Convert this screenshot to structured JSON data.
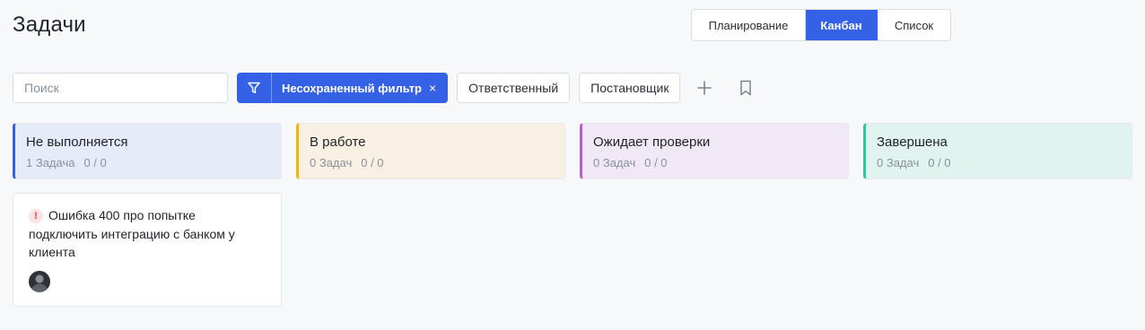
{
  "header": {
    "title": "Задачи",
    "views": [
      "Планирование",
      "Канбан",
      "Список"
    ],
    "active_view": "Канбан"
  },
  "toolbar": {
    "search_placeholder": "Поиск",
    "filter_label": "Несохраненный фильтр",
    "filter_close": "×",
    "assignee_label": "Ответственный",
    "reporter_label": "Постановщик"
  },
  "columns": [
    {
      "title": "Не выполняется",
      "count_label": "1 Задача",
      "ratio": "0 / 0",
      "accent": "#3461e6",
      "bg": "#e6ebf9"
    },
    {
      "title": "В работе",
      "count_label": "0 Задач",
      "ratio": "0 / 0",
      "accent": "#f2b705",
      "bg": "#f8f0e2"
    },
    {
      "title": "Ожидает проверки",
      "count_label": "0 Задач",
      "ratio": "0 / 0",
      "accent": "#b85cd0",
      "bg": "#f1e8f5"
    },
    {
      "title": "Завершена",
      "count_label": "0 Задач",
      "ratio": "0 / 0",
      "accent": "#2ec7a2",
      "bg": "#e0f3ef"
    }
  ],
  "cards": [
    {
      "text": "Ошибка 400 про попытке подключить интеграцию с банком у клиента",
      "priority_icon": "!"
    }
  ],
  "colors": {
    "primary": "#3461e6",
    "page_bg": "#f7f8fa"
  }
}
